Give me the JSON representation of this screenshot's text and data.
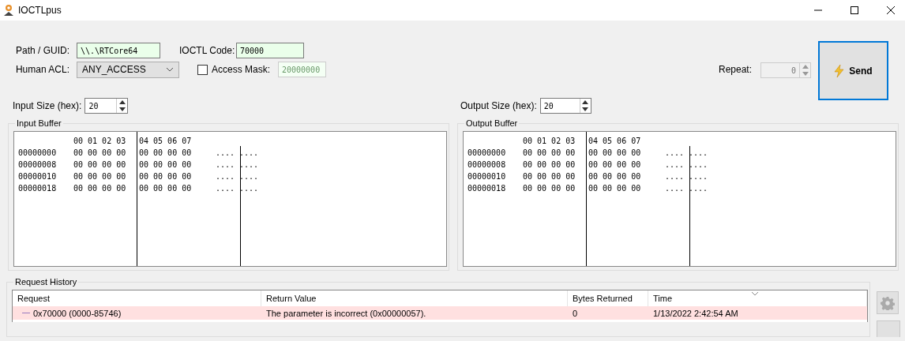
{
  "window": {
    "title": "IOCTLpus"
  },
  "form": {
    "path_label": "Path / GUID:",
    "path_value": "\\\\.\\RTCore64",
    "ioctl_label": "IOCTL Code:",
    "ioctl_value": "70000",
    "acl_label": "Human ACL:",
    "acl_value": "ANY_ACCESS",
    "access_mask": {
      "label": "Access Mask:",
      "checked": false,
      "value": "20000000",
      "disabled": true
    },
    "repeat": {
      "label": "Repeat:",
      "value": "0",
      "disabled": true
    },
    "send_button": "Send",
    "input_size_label": "Input Size (hex):",
    "input_size": "20",
    "output_size_label": "Output Size (hex):",
    "output_size": "20"
  },
  "buffers": [
    {
      "title": "Input Buffer",
      "header_left": "00 01 02 03",
      "header_right": "04 05 06 07",
      "rows": [
        {
          "address": "00000000",
          "hex_left": "00 00 00 00",
          "hex_right": "00 00 00 00",
          "ascii_left": "....",
          "ascii_right": "...."
        },
        {
          "address": "00000008",
          "hex_left": "00 00 00 00",
          "hex_right": "00 00 00 00",
          "ascii_left": "....",
          "ascii_right": "...."
        },
        {
          "address": "00000010",
          "hex_left": "00 00 00 00",
          "hex_right": "00 00 00 00",
          "ascii_left": "....",
          "ascii_right": "...."
        },
        {
          "address": "00000018",
          "hex_left": "00 00 00 00",
          "hex_right": "00 00 00 00",
          "ascii_left": "....",
          "ascii_right": "...."
        }
      ]
    },
    {
      "title": "Output Buffer",
      "header_left": "00 01 02 03",
      "header_right": "04 05 06 07",
      "rows": [
        {
          "address": "00000000",
          "hex_left": "00 00 00 00",
          "hex_right": "00 00 00 00",
          "ascii_left": "....",
          "ascii_right": "...."
        },
        {
          "address": "00000008",
          "hex_left": "00 00 00 00",
          "hex_right": "00 00 00 00",
          "ascii_left": "....",
          "ascii_right": "...."
        },
        {
          "address": "00000010",
          "hex_left": "00 00 00 00",
          "hex_right": "00 00 00 00",
          "ascii_left": "....",
          "ascii_right": "...."
        },
        {
          "address": "00000018",
          "hex_left": "00 00 00 00",
          "hex_right": "00 00 00 00",
          "ascii_left": "....",
          "ascii_right": "...."
        }
      ]
    }
  ],
  "history": {
    "title": "Request History",
    "columns": [
      "Request",
      "Return Value",
      "Bytes Returned",
      "Time"
    ],
    "rows": [
      {
        "color": "#ffe0e0",
        "cells": [
          "0x70000 (0000-85746)",
          "The parameter is incorrect (0x00000057).",
          "0",
          "1/13/2022 2:42:54 AM"
        ]
      }
    ]
  }
}
